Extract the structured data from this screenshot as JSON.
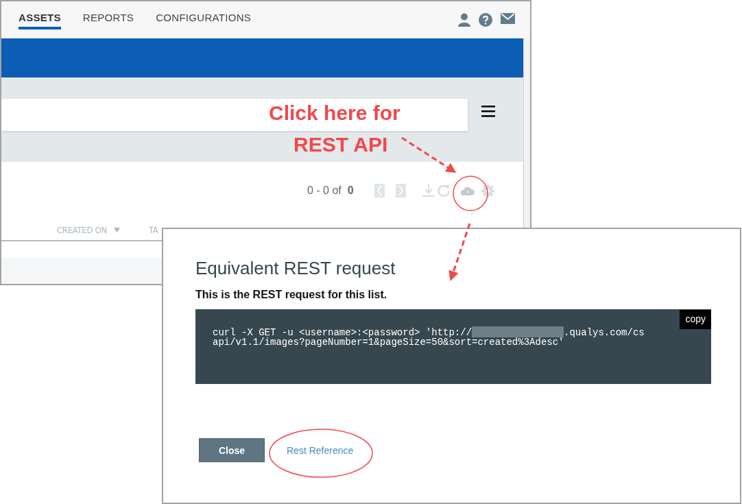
{
  "app": {
    "tabs": [
      {
        "label": "ASSETS",
        "selected": true
      },
      {
        "label": "REPORTS",
        "selected": false
      },
      {
        "label": "CONFIGURATIONS",
        "selected": false
      }
    ],
    "pagination": {
      "range": "0 - 0 of",
      "total": "0"
    },
    "columns": [
      {
        "label": "CREATED ON",
        "sorted": true
      },
      {
        "label": "TA"
      }
    ]
  },
  "dialog": {
    "title": "Equivalent REST request",
    "subtitle": "This is the REST request for this list.",
    "request": {
      "line_1_start": "curl -X GET -u <username>:<password> 'http://",
      "line_1_end": ".qualys.com/cs",
      "line_2": "api/v1.1/images?pageNumber=1&pageSize=50&sort=created%3Adesc'"
    },
    "copy_button": "copy",
    "close_button": "Close",
    "reference_link": "Rest Reference"
  },
  "annotation": {
    "lines": [
      "Click here for",
      "REST API"
    ]
  }
}
